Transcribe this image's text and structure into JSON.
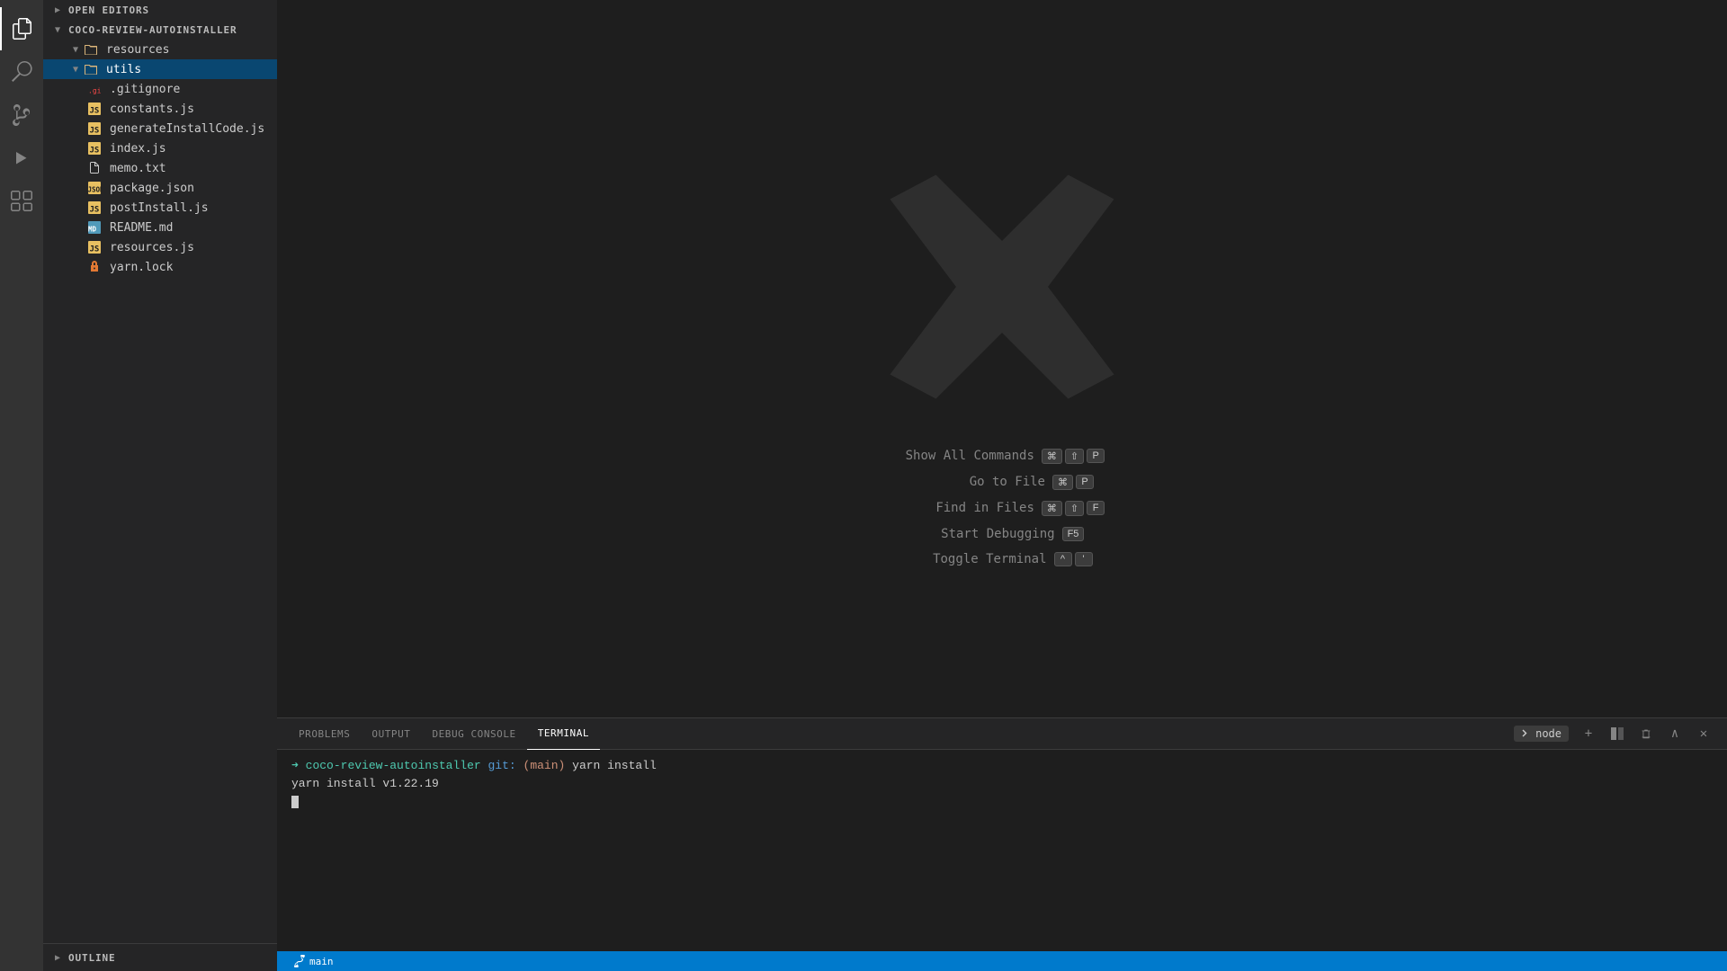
{
  "activityBar": {
    "icons": [
      {
        "name": "explorer-icon",
        "symbol": "⧉",
        "active": true
      },
      {
        "name": "search-icon",
        "symbol": "🔍",
        "active": false
      },
      {
        "name": "source-control-icon",
        "symbol": "⎇",
        "active": false
      },
      {
        "name": "debug-icon",
        "symbol": "▷",
        "active": false
      },
      {
        "name": "extensions-icon",
        "symbol": "⊞",
        "active": false
      }
    ]
  },
  "sidebar": {
    "openEditors": {
      "label": "Open Editors",
      "collapsed": true
    },
    "projectName": "COCO-REVIEW-AUTOINSTALLER",
    "tree": [
      {
        "type": "folder",
        "label": "resources",
        "indent": 0,
        "expanded": true,
        "iconClass": "folder-icon"
      },
      {
        "type": "folder",
        "label": "utils",
        "indent": 0,
        "expanded": true,
        "iconClass": "folder-icon",
        "selected": true
      },
      {
        "type": "file",
        "label": ".gitignore",
        "indent": 1,
        "iconClass": "git-icon"
      },
      {
        "type": "file",
        "label": "constants.js",
        "indent": 1,
        "iconClass": "js-icon"
      },
      {
        "type": "file",
        "label": "generateInstallCode.js",
        "indent": 1,
        "iconClass": "js-icon"
      },
      {
        "type": "file",
        "label": "index.js",
        "indent": 1,
        "iconClass": "js-icon"
      },
      {
        "type": "file",
        "label": "memo.txt",
        "indent": 1,
        "iconClass": "txt-icon"
      },
      {
        "type": "file",
        "label": "package.json",
        "indent": 1,
        "iconClass": "json-icon"
      },
      {
        "type": "file",
        "label": "postInstall.js",
        "indent": 1,
        "iconClass": "js-icon"
      },
      {
        "type": "file",
        "label": "README.md",
        "indent": 1,
        "iconClass": "md-icon"
      },
      {
        "type": "file",
        "label": "resources.js",
        "indent": 1,
        "iconClass": "js-icon"
      },
      {
        "type": "file",
        "label": "yarn.lock",
        "indent": 1,
        "iconClass": "lock-icon"
      }
    ],
    "outline": {
      "label": "OUTLINE"
    }
  },
  "editor": {
    "vscodeLogoVisible": true,
    "shortcuts": [
      {
        "label": "Show All Commands",
        "keys": [
          "⌘",
          "⇧",
          "P"
        ]
      },
      {
        "label": "Go to File",
        "keys": [
          "⌘",
          "P"
        ]
      },
      {
        "label": "Find in Files",
        "keys": [
          "⌘",
          "⇧",
          "F"
        ]
      },
      {
        "label": "Start Debugging",
        "keys": [
          "F5"
        ]
      },
      {
        "label": "Toggle Terminal",
        "keys": [
          "^",
          "'"
        ]
      }
    ]
  },
  "panel": {
    "tabs": [
      {
        "label": "PROBLEMS",
        "active": false
      },
      {
        "label": "OUTPUT",
        "active": false
      },
      {
        "label": "DEBUG CONSOLE",
        "active": false
      },
      {
        "label": "TERMINAL",
        "active": true
      }
    ],
    "nodeIndicator": "node",
    "actions": [
      {
        "name": "new-terminal-icon",
        "symbol": "+"
      },
      {
        "name": "split-terminal-icon",
        "symbol": "⬜"
      },
      {
        "name": "trash-terminal-icon",
        "symbol": "🗑"
      },
      {
        "name": "maximize-panel-icon",
        "symbol": "∧"
      },
      {
        "name": "close-panel-icon",
        "symbol": "✕"
      }
    ]
  },
  "terminal": {
    "lines": [
      {
        "arrow": "➜",
        "path": "coco-review-autoinstaller",
        "git": "git:",
        "branch": "(main)",
        "command": " yarn install"
      },
      {
        "text": "yarn install v1.22.19"
      }
    ]
  },
  "statusBar": {
    "leftItems": [
      {
        "label": "⎇ main",
        "name": "git-branch-status"
      }
    ],
    "rightItems": []
  }
}
